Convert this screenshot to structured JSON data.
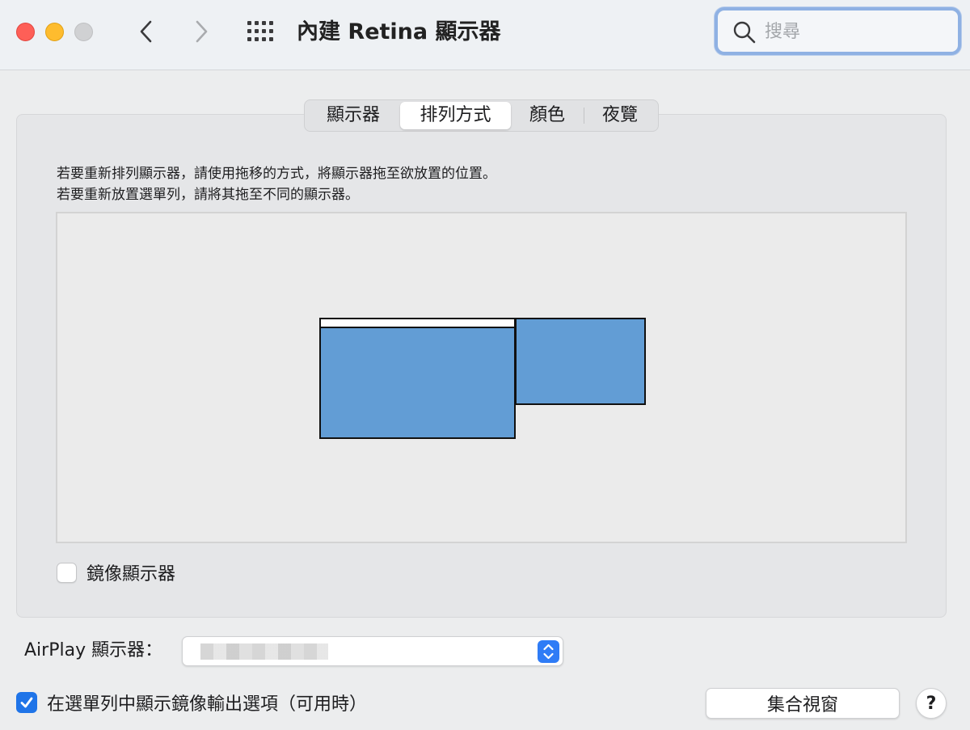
{
  "window": {
    "title": "內建 Retina 顯示器",
    "traffic_lights": {
      "close": "#fe5f57",
      "minimize": "#febc2e",
      "zoom": "#d0d1d3"
    },
    "icons": {
      "back": "chevron-left-icon",
      "forward": "chevron-right-icon",
      "show_all": "grid-icon",
      "search": "magnifier-icon"
    }
  },
  "search": {
    "placeholder": "搜尋",
    "value": ""
  },
  "tabs": [
    {
      "label": "顯示器",
      "selected": false
    },
    {
      "label": "排列方式",
      "selected": true
    },
    {
      "label": "顏色",
      "selected": false
    },
    {
      "label": "夜覽",
      "selected": false
    }
  ],
  "arrangement": {
    "instruction_line1": "若要重新排列顯示器，請使用拖移的方式，將顯示器拖至欲放置的位置。",
    "instruction_line2": "若要重新放置選單列，請將其拖至不同的顯示器。",
    "display_color": "#629dd5",
    "mirror_label": "鏡像顯示器",
    "mirror_checked": false
  },
  "airplay": {
    "label": "AirPlay 顯示器：",
    "selected_value_obscured": true
  },
  "options": {
    "show_mirroring_label": "在選單列中顯示鏡像輸出選項（可用時）",
    "show_mirroring_checked": true
  },
  "buttons": {
    "gather_windows": "集合視窗",
    "help": "?"
  },
  "colors": {
    "accent": "#1f74e8",
    "focus_ring": "#8fb1e3"
  }
}
